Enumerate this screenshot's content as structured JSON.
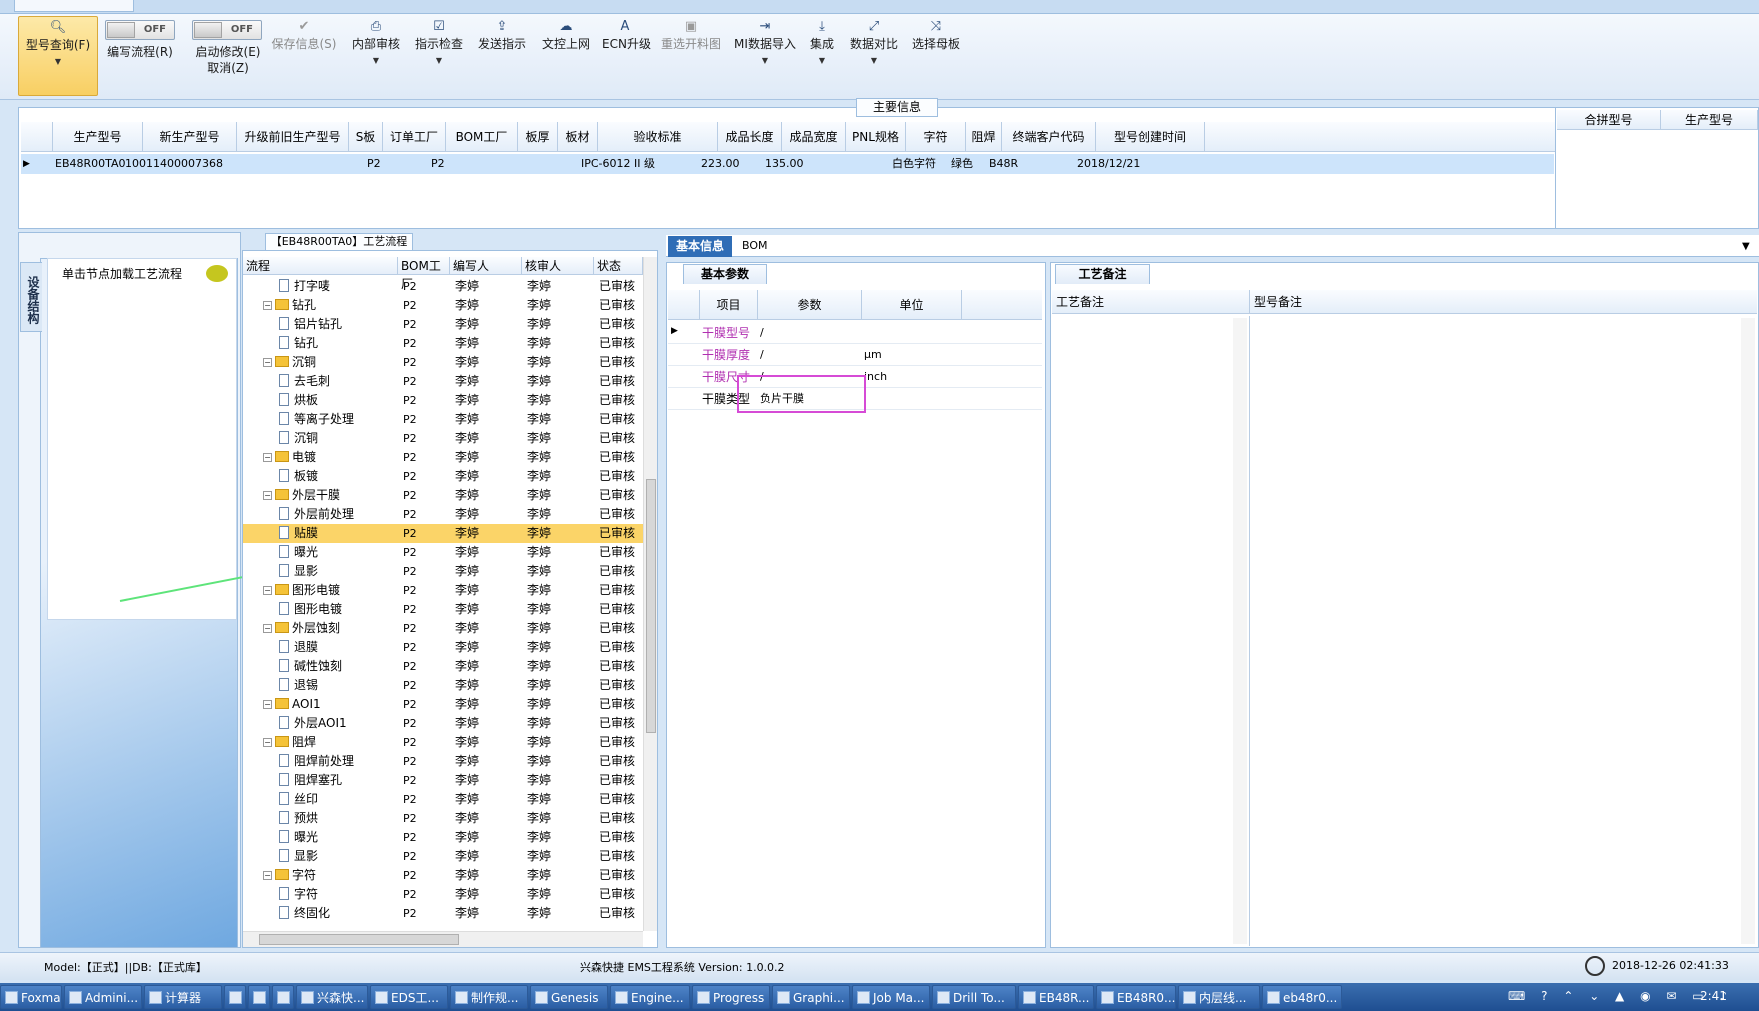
{
  "toolbar": {
    "query": "型号查询(F)",
    "toggle_off": "OFF",
    "write_flow": "编写流程(R)",
    "start_modify": "启动修改(E)",
    "cancel": "取消(Z)",
    "save_info": "保存信息(S)",
    "internal_review": "内部审核",
    "instruction_check": "指示检查",
    "send_instruction": "发送指示",
    "doc_upload": "文控上网",
    "ecn_upgrade": "ECN升级",
    "reselect_drawing": "重选开料图",
    "mi_import": "MI数据导入",
    "integrate": "集成",
    "data_compare": "数据对比",
    "select_board": "选择母板"
  },
  "main_info": {
    "title": "主要信息",
    "headers": [
      "生产型号",
      "新生产型号",
      "升级前旧生产型号",
      "S板",
      "订单工厂",
      "BOM工厂",
      "板厚",
      "板材",
      "验收标准",
      "成品长度",
      "成品宽度",
      "PNL规格",
      "字符",
      "阻焊",
      "终端客户代码",
      "型号创建时间"
    ],
    "right_headers": [
      "合拼型号",
      "生产型号"
    ],
    "row": {
      "prod_no": "EB48R00TA0",
      "new_prod_no": "10011400007368",
      "order_factory": "P2",
      "bom_factory": "P2",
      "standard": "IPC-6012 II 级",
      "length": "223.00",
      "width": "135.00",
      "char": "白色字符",
      "mask": "绿色",
      "customer": "B48R",
      "created": "2018/12/21"
    }
  },
  "left_nav": {
    "vtab": "设备结构",
    "hint": "单击节点加载工艺流程"
  },
  "tree": {
    "title": "【EB48R00TA0】工艺流程",
    "headers": [
      "流程",
      "BOM工厂",
      "编写人",
      "核审人",
      "状态"
    ],
    "rows": [
      {
        "name": "打字唛",
        "level": 2,
        "factory": "P2",
        "writer": "李婷",
        "reviewer": "李婷",
        "status": "已审核"
      },
      {
        "name": "钻孔",
        "level": 1,
        "factory": "P2",
        "writer": "李婷",
        "reviewer": "李婷",
        "status": "已审核"
      },
      {
        "name": "铝片钻孔",
        "level": 2,
        "factory": "P2",
        "writer": "李婷",
        "reviewer": "李婷",
        "status": "已审核"
      },
      {
        "name": "钻孔",
        "level": 2,
        "factory": "P2",
        "writer": "李婷",
        "reviewer": "李婷",
        "status": "已审核"
      },
      {
        "name": "沉铜",
        "level": 1,
        "factory": "P2",
        "writer": "李婷",
        "reviewer": "李婷",
        "status": "已审核"
      },
      {
        "name": "去毛刺",
        "level": 2,
        "factory": "P2",
        "writer": "李婷",
        "reviewer": "李婷",
        "status": "已审核"
      },
      {
        "name": "烘板",
        "level": 2,
        "factory": "P2",
        "writer": "李婷",
        "reviewer": "李婷",
        "status": "已审核"
      },
      {
        "name": "等离子处理",
        "level": 2,
        "factory": "P2",
        "writer": "李婷",
        "reviewer": "李婷",
        "status": "已审核"
      },
      {
        "name": "沉铜",
        "level": 2,
        "factory": "P2",
        "writer": "李婷",
        "reviewer": "李婷",
        "status": "已审核"
      },
      {
        "name": "电镀",
        "level": 1,
        "factory": "P2",
        "writer": "李婷",
        "reviewer": "李婷",
        "status": "已审核"
      },
      {
        "name": "板镀",
        "level": 2,
        "factory": "P2",
        "writer": "李婷",
        "reviewer": "李婷",
        "status": "已审核"
      },
      {
        "name": "外层干膜",
        "level": 1,
        "factory": "P2",
        "writer": "李婷",
        "reviewer": "李婷",
        "status": "已审核"
      },
      {
        "name": "外层前处理",
        "level": 2,
        "factory": "P2",
        "writer": "李婷",
        "reviewer": "李婷",
        "status": "已审核"
      },
      {
        "name": "贴膜",
        "level": 2,
        "factory": "P2",
        "writer": "李婷",
        "reviewer": "李婷",
        "status": "已审核",
        "selected": true
      },
      {
        "name": "曝光",
        "level": 2,
        "factory": "P2",
        "writer": "李婷",
        "reviewer": "李婷",
        "status": "已审核"
      },
      {
        "name": "显影",
        "level": 2,
        "factory": "P2",
        "writer": "李婷",
        "reviewer": "李婷",
        "status": "已审核"
      },
      {
        "name": "图形电镀",
        "level": 1,
        "factory": "P2",
        "writer": "李婷",
        "reviewer": "李婷",
        "status": "已审核"
      },
      {
        "name": "图形电镀",
        "level": 2,
        "factory": "P2",
        "writer": "李婷",
        "reviewer": "李婷",
        "status": "已审核"
      },
      {
        "name": "外层蚀刻",
        "level": 1,
        "factory": "P2",
        "writer": "李婷",
        "reviewer": "李婷",
        "status": "已审核"
      },
      {
        "name": "退膜",
        "level": 2,
        "factory": "P2",
        "writer": "李婷",
        "reviewer": "李婷",
        "status": "已审核"
      },
      {
        "name": "碱性蚀刻",
        "level": 2,
        "factory": "P2",
        "writer": "李婷",
        "reviewer": "李婷",
        "status": "已审核"
      },
      {
        "name": "退锡",
        "level": 2,
        "factory": "P2",
        "writer": "李婷",
        "reviewer": "李婷",
        "status": "已审核"
      },
      {
        "name": "AOI1",
        "level": 1,
        "factory": "P2",
        "writer": "李婷",
        "reviewer": "李婷",
        "status": "已审核"
      },
      {
        "name": "外层AOI1",
        "level": 2,
        "factory": "P2",
        "writer": "李婷",
        "reviewer": "李婷",
        "status": "已审核"
      },
      {
        "name": "阻焊",
        "level": 1,
        "factory": "P2",
        "writer": "李婷",
        "reviewer": "李婷",
        "status": "已审核"
      },
      {
        "name": "阻焊前处理",
        "level": 2,
        "factory": "P2",
        "writer": "李婷",
        "reviewer": "李婷",
        "status": "已审核"
      },
      {
        "name": "阻焊塞孔",
        "level": 2,
        "factory": "P2",
        "writer": "李婷",
        "reviewer": "李婷",
        "status": "已审核"
      },
      {
        "name": "丝印",
        "level": 2,
        "factory": "P2",
        "writer": "李婷",
        "reviewer": "李婷",
        "status": "已审核"
      },
      {
        "name": "预烘",
        "level": 2,
        "factory": "P2",
        "writer": "李婷",
        "reviewer": "李婷",
        "status": "已审核"
      },
      {
        "name": "曝光",
        "level": 2,
        "factory": "P2",
        "writer": "李婷",
        "reviewer": "李婷",
        "status": "已审核"
      },
      {
        "name": "显影",
        "level": 2,
        "factory": "P2",
        "writer": "李婷",
        "reviewer": "李婷",
        "status": "已审核"
      },
      {
        "name": "字符",
        "level": 1,
        "factory": "P2",
        "writer": "李婷",
        "reviewer": "李婷",
        "status": "已审核"
      },
      {
        "name": "字符",
        "level": 2,
        "factory": "P2",
        "writer": "李婷",
        "reviewer": "李婷",
        "status": "已审核"
      },
      {
        "name": "终固化",
        "level": 2,
        "factory": "P2",
        "writer": "李婷",
        "reviewer": "李婷",
        "status": "已审核"
      }
    ]
  },
  "right": {
    "tab_basic": "基本信息",
    "tab_bom": "BOM",
    "params_tab": "基本参数",
    "params_headers": [
      "项目",
      "参数",
      "单位"
    ],
    "params": [
      {
        "name": "干膜型号",
        "value": "/",
        "unit": "",
        "highlight": true
      },
      {
        "name": "干膜厚度",
        "value": "/",
        "unit": "μm",
        "highlight": true
      },
      {
        "name": "干膜尺寸",
        "value": "/",
        "unit": "inch",
        "highlight": true
      },
      {
        "name": "干膜类型",
        "value": "负片干膜",
        "unit": "",
        "highlight": false
      }
    ],
    "remarks_tab": "工艺备注",
    "remarks_headers": [
      "工艺备注",
      "型号备注"
    ]
  },
  "status": {
    "model": "Model:【正式】||DB:【正式库】",
    "system": "兴森快捷 EMS工程系统 Version: 1.0.0.2",
    "time": "2018-12-26 02:41:33"
  },
  "taskbar": {
    "items": [
      "Foxmail",
      "Admini...",
      "计算器",
      "",
      "",
      "",
      "兴森快...",
      "EDS工...",
      "制作规...",
      "Genesis",
      "Engine...",
      "Progress",
      "Graphi...",
      "Job Ma...",
      "Drill To...",
      "EB48R...",
      "EB48R0...",
      "内层线...",
      "eb48r0..."
    ],
    "time": "2:41"
  }
}
